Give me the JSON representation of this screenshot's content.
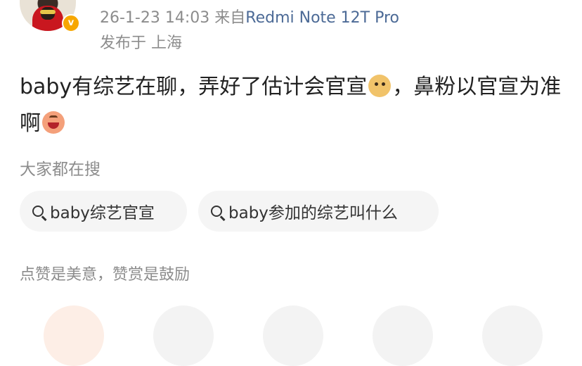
{
  "post": {
    "timestamp": "26-1-23 14:03",
    "source_prefix": "来自",
    "device": "Redmi Note 12T Pro",
    "location": "发布于 上海",
    "text_part1": "baby有综艺在聊，弄好了估计会官宣",
    "text_part2": "，鼻粉以官宣为准啊",
    "emojis": [
      "doge-emoji",
      "laugh-emoji"
    ]
  },
  "search_section": {
    "label": "大家都在搜",
    "chips": [
      "baby综艺官宣",
      "baby参加的综艺叫什么"
    ]
  },
  "reward": {
    "label": "点赞是美意，赞赏是鼓励"
  },
  "colors": {
    "meta_gray": "#8c8c8c",
    "device_blue": "#4c6a96",
    "verified_badge": "#f7a700",
    "chip_bg": "#f5f5f5"
  }
}
